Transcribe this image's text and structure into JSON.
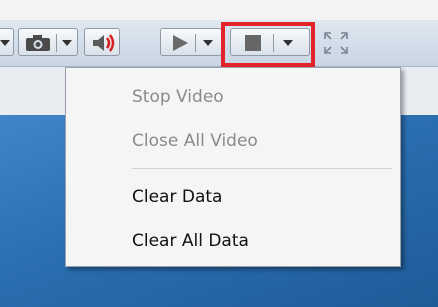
{
  "menu": {
    "items": [
      {
        "label": "Stop Video",
        "enabled": false
      },
      {
        "label": "Close All Video",
        "enabled": false
      },
      {
        "label": "Clear Data",
        "enabled": true
      },
      {
        "label": "Clear All Data",
        "enabled": true
      }
    ]
  },
  "toolbar": {
    "icons": [
      "partial-button",
      "camera-icon",
      "mute-speaker-icon",
      "play-icon",
      "stop-icon",
      "fullscreen-icon"
    ],
    "highlight_color": "#e3232b"
  },
  "colors": {
    "desktop": "#2a6fb0",
    "disabled_text": "#8a8a8a"
  }
}
